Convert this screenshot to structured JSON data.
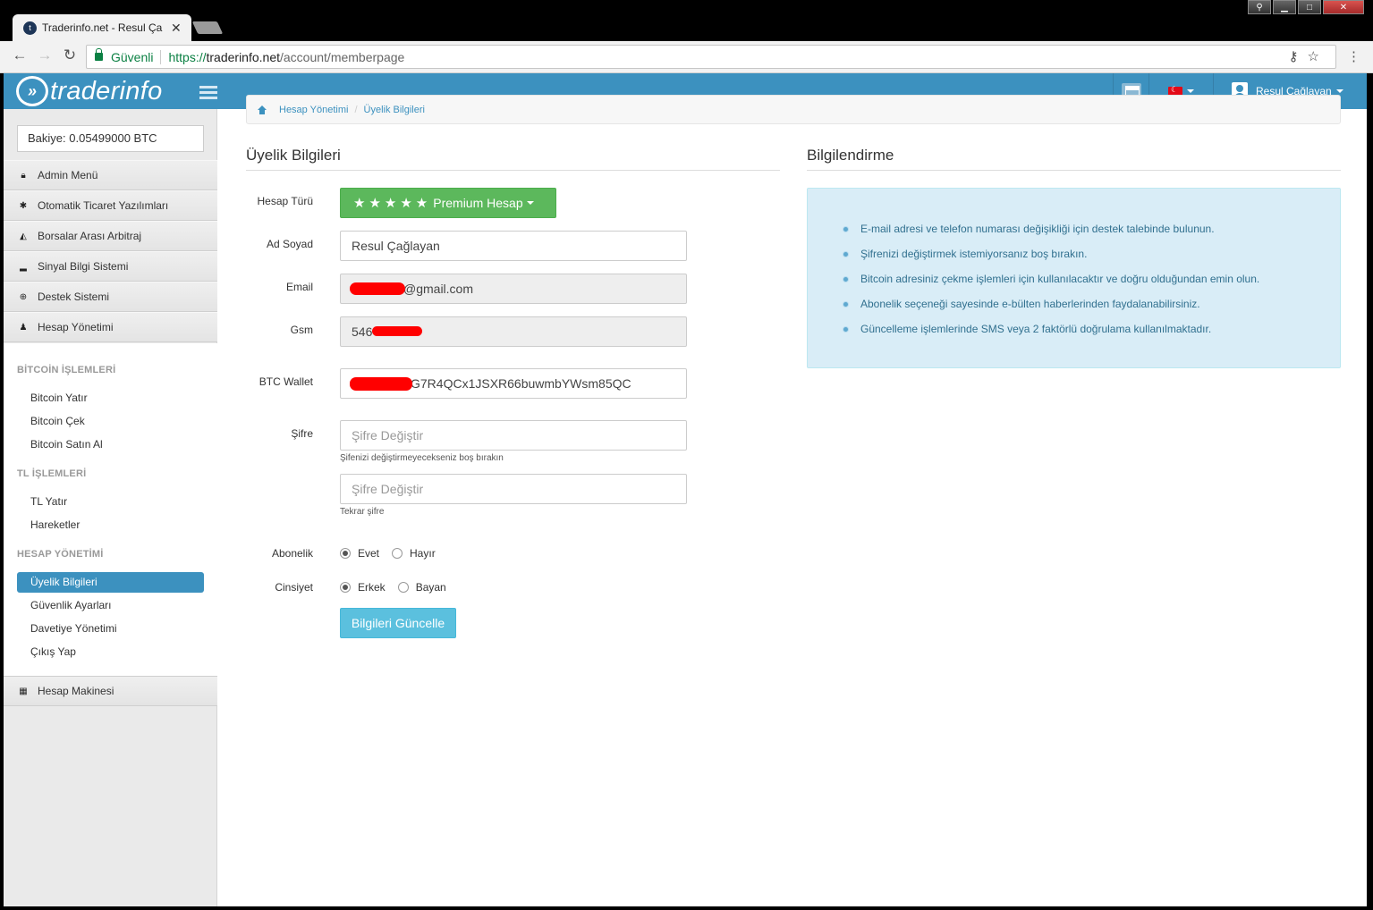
{
  "browser": {
    "tab_title": "Traderinfo.net - Resul Ça",
    "secure_label": "Güvenli",
    "url_scheme": "https://",
    "url_host": "traderinfo.net",
    "url_path": "/account/memberpage"
  },
  "topbar": {
    "logo_text": "traderinfo",
    "user_name": "Resul Çağlayan"
  },
  "sidebar": {
    "balance": "Bakiye: 0.05499000 BTC",
    "menu": [
      {
        "label": "Admin Menü",
        "icon": "lock-icon"
      },
      {
        "label": "Otomatik Ticaret Yazılımları",
        "icon": "android-icon"
      },
      {
        "label": "Borsalar Arası Arbitraj",
        "icon": "area-chart-icon"
      },
      {
        "label": "Sinyal Bilgi Sistemi",
        "icon": "signal-icon"
      },
      {
        "label": "Destek Sistemi",
        "icon": "lifebuoy-icon"
      },
      {
        "label": "Hesap Yönetimi",
        "icon": "user-icon"
      }
    ],
    "sections": {
      "bitcoin": {
        "heading": "BİTCOİN İŞLEMLERİ",
        "links": [
          "Bitcoin Yatır",
          "Bitcoin Çek",
          "Bitcoin Satın Al"
        ]
      },
      "tl": {
        "heading": "TL İŞLEMLERİ",
        "links": [
          "TL Yatır",
          "Hareketler"
        ]
      },
      "account": {
        "heading": "HESAP YÖNETİMİ",
        "links": [
          "Üyelik Bilgileri",
          "Güvenlik Ayarları",
          "Davetiye Yönetimi",
          "Çıkış Yap"
        ]
      }
    },
    "bottom_item": {
      "label": "Hesap Makinesi",
      "icon": "calculator-icon"
    }
  },
  "breadcrumb": [
    "Hesap Yönetimi",
    "Üyelik Bilgileri"
  ],
  "form": {
    "title": "Üyelik Bilgileri",
    "account_type_label": "Hesap Türü",
    "account_type_value": "Premium Hesap",
    "stars": "★★★★★",
    "name_label": "Ad Soyad",
    "name_value": "Resul Çağlayan",
    "email_label": "Email",
    "email_value": "@gmail.com",
    "gsm_label": "Gsm",
    "gsm_value": "546",
    "wallet_label": "BTC Wallet",
    "wallet_value": "G7R4QCx1JSXR66buwmbYWsm85QC",
    "password_label": "Şifre",
    "password_placeholder": "Şifre Değiştir",
    "password_help": "Şifenizi değiştirmeyecekseniz boş bırakın",
    "password2_placeholder": "Şifre Değiştir",
    "password2_help": "Tekrar şifre",
    "subscription_label": "Abonelik",
    "subscription_yes": "Evet",
    "subscription_no": "Hayır",
    "gender_label": "Cinsiyet",
    "gender_male": "Erkek",
    "gender_female": "Bayan",
    "submit_label": "Bilgileri Güncelle"
  },
  "info": {
    "title": "Bilgilendirme",
    "items": [
      "E-mail adresi ve telefon numarası değişikliği için destek talebinde bulunun.",
      "Şifrenizi değiştirmek istemiyorsanız boş bırakın.",
      "Bitcoin adresiniz çekme işlemleri için kullanılacaktır ve doğru olduğundan emin olun.",
      "Abonelik seçeneği sayesinde e-bülten haberlerinden faydalanabilirsiniz.",
      "Güncelleme işlemlerinde SMS veya 2 faktörlü doğrulama kullanılmaktadır."
    ]
  },
  "colors": {
    "brand": "#3c91bf",
    "success": "#5cb85c",
    "info_btn": "#5bc0de",
    "info_bg": "#d9edf7"
  }
}
